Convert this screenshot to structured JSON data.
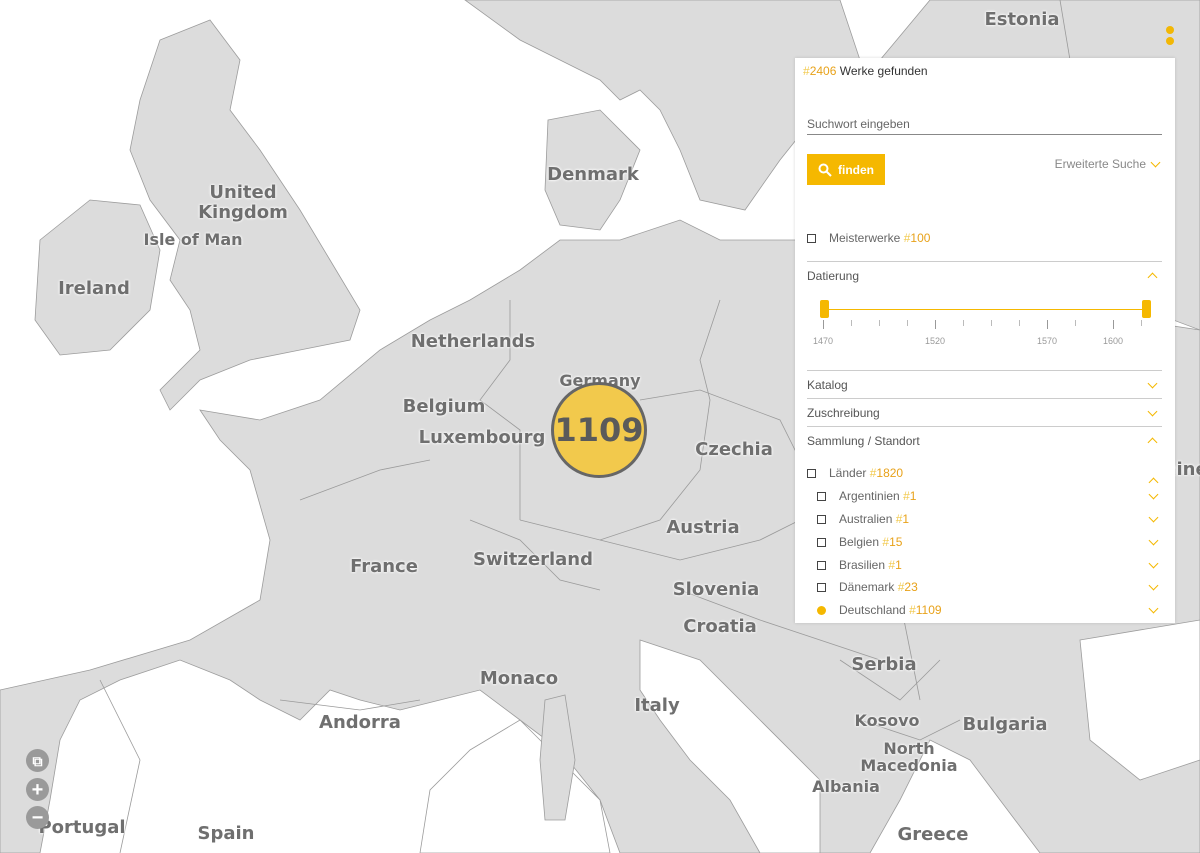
{
  "map": {
    "countries": [
      {
        "key": "estonia",
        "label": "Estonia"
      },
      {
        "key": "denmark",
        "label": "Denmark"
      },
      {
        "key": "uk",
        "label": "United\nKingdom"
      },
      {
        "key": "isle_of_man",
        "label": "Isle of Man"
      },
      {
        "key": "ireland",
        "label": "Ireland"
      },
      {
        "key": "netherlands",
        "label": "Netherlands"
      },
      {
        "key": "germany",
        "label": "Germany"
      },
      {
        "key": "belgium",
        "label": "Belgium"
      },
      {
        "key": "luxembourg",
        "label": "Luxembourg"
      },
      {
        "key": "czechia",
        "label": "Czechia"
      },
      {
        "key": "france",
        "label": "France"
      },
      {
        "key": "switzerland",
        "label": "Switzerland"
      },
      {
        "key": "austria",
        "label": "Austria"
      },
      {
        "key": "slovenia",
        "label": "Slovenia"
      },
      {
        "key": "croatia",
        "label": "Croatia"
      },
      {
        "key": "monaco",
        "label": "Monaco"
      },
      {
        "key": "italy",
        "label": "Italy"
      },
      {
        "key": "serbia",
        "label": "Serbia"
      },
      {
        "key": "andorra",
        "label": "Andorra"
      },
      {
        "key": "kosovo",
        "label": "Kosovo"
      },
      {
        "key": "bulgaria",
        "label": "Bulgaria"
      },
      {
        "key": "north_macedonia",
        "label": "North\nMacedonia"
      },
      {
        "key": "albania",
        "label": "Albania"
      },
      {
        "key": "portugal",
        "label": "Portugal"
      },
      {
        "key": "spain",
        "label": "Spain"
      },
      {
        "key": "greece",
        "label": "Greece"
      },
      {
        "key": "ukraine_partial",
        "label": "aine"
      }
    ],
    "cluster": {
      "count": "1109",
      "color": "#f2c94c"
    },
    "zoom": {
      "collapse_icon": "collapse-icon",
      "zoom_in_icon": "plus-icon",
      "zoom_out_icon": "minus-icon"
    }
  },
  "panel": {
    "results_hash": "#",
    "results_count": "2406",
    "results_text": "Werke gefunden",
    "search_placeholder": "Suchwort eingeben",
    "find_label": "finden",
    "advanced_label": "Erweiterte Suche",
    "masterworks": {
      "label": "Meisterwerke",
      "hash": "#",
      "count": "100"
    },
    "dating": {
      "label": "Datierung",
      "ticks": [
        "1470",
        "1520",
        "1570",
        "1600"
      ]
    },
    "catalog_label": "Katalog",
    "attribution_label": "Zuschreibung",
    "collection_label": "Sammlung / Standort",
    "countries": {
      "label": "Länder",
      "hash": "#",
      "count": "1820"
    },
    "country_items": [
      {
        "label": "Argentinien",
        "hash": "#",
        "count": "1",
        "selected": false
      },
      {
        "label": "Australien",
        "hash": "#",
        "count": "1",
        "selected": false
      },
      {
        "label": "Belgien",
        "hash": "#",
        "count": "15",
        "selected": false
      },
      {
        "label": "Brasilien",
        "hash": "#",
        "count": "1",
        "selected": false
      },
      {
        "label": "Dänemark",
        "hash": "#",
        "count": "23",
        "selected": false
      },
      {
        "label": "Deutschland",
        "hash": "#",
        "count": "1109",
        "selected": true
      }
    ],
    "accent_color": "#f5b800"
  }
}
